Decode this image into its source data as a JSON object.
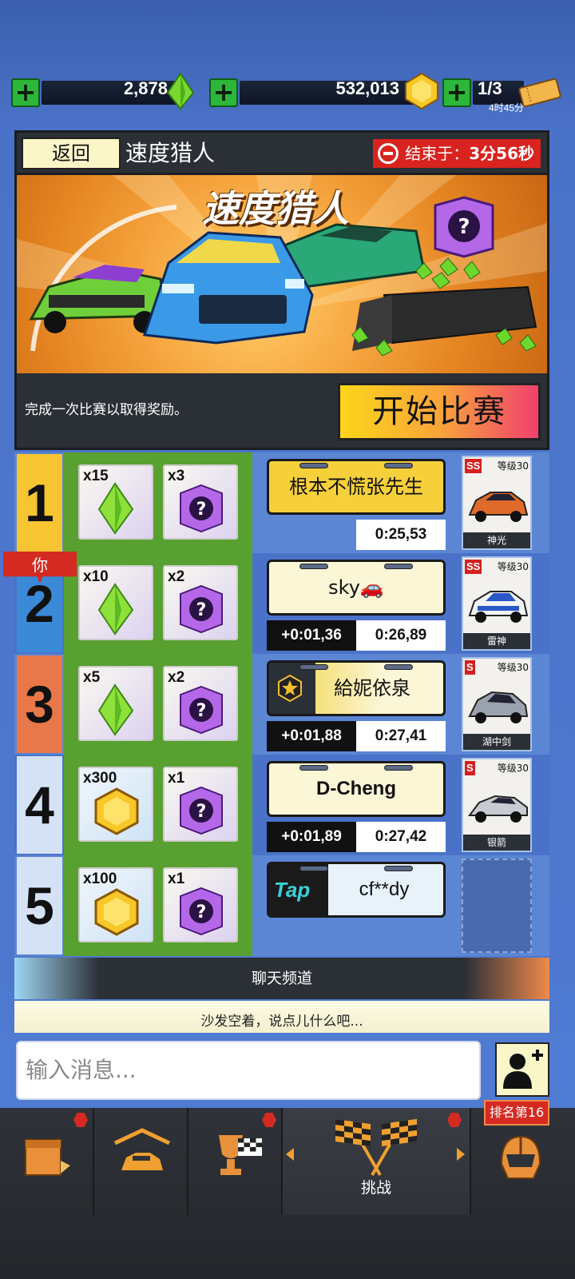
{
  "currencies": {
    "gems": "2,878",
    "coins": "532,013",
    "tickets": "1/3",
    "ticket_timer": "4时45分"
  },
  "header": {
    "back_label": "返回",
    "title": "速度猎人",
    "timer_prefix": "结束于：",
    "timer_value": "3分56秒"
  },
  "banner": {
    "title": "速度猎人"
  },
  "start": {
    "hint": "完成一次比赛以取得奖励。",
    "button_label": "开始比赛"
  },
  "you_tag": "你",
  "leaderboard": [
    {
      "rank": "1",
      "reward_a": {
        "qty": "x15",
        "icon": "gem-icon"
      },
      "reward_b": {
        "qty": "x3",
        "icon": "mystery-box-icon"
      },
      "player": "根本不慌张先生",
      "gap": "",
      "time": "0:25,53",
      "car": {
        "tier": "SS",
        "level": "等级30",
        "name": "神光",
        "color": "#e06a2a"
      }
    },
    {
      "rank": "2",
      "reward_a": {
        "qty": "x10",
        "icon": "gem-icon"
      },
      "reward_b": {
        "qty": "x2",
        "icon": "mystery-box-icon"
      },
      "player": "sky🚗",
      "gap": "+0:01,36",
      "time": "0:26,89",
      "car": {
        "tier": "SS",
        "level": "等级30",
        "name": "雷神",
        "color": "#2a58c8"
      }
    },
    {
      "rank": "3",
      "reward_a": {
        "qty": "x5",
        "icon": "gem-icon"
      },
      "reward_b": {
        "qty": "x2",
        "icon": "mystery-box-icon"
      },
      "player": "給妮依泉",
      "gap": "+0:01,88",
      "time": "0:27,41",
      "car": {
        "tier": "S",
        "level": "等级30",
        "name": "湖中剑",
        "color": "#9aa3ad"
      }
    },
    {
      "rank": "4",
      "reward_a": {
        "qty": "x300",
        "icon": "coin-icon"
      },
      "reward_b": {
        "qty": "x1",
        "icon": "mystery-box-icon"
      },
      "player": "D-Cheng",
      "gap": "+0:01,89",
      "time": "0:27,42",
      "car": {
        "tier": "S",
        "level": "等级30",
        "name": "银箭",
        "color": "#c8ccd2"
      }
    },
    {
      "rank": "5",
      "reward_a": {
        "qty": "x100",
        "icon": "coin-icon"
      },
      "reward_b": {
        "qty": "x1",
        "icon": "mystery-box-icon"
      },
      "player": "cf**dy",
      "plate_badge": "Tap",
      "gap": "",
      "time": "",
      "car": null
    }
  ],
  "chat": {
    "header": "聊天频道",
    "message": "沙发空着，说点儿什么吧...",
    "input_placeholder": "输入消息..."
  },
  "nav": {
    "active_label": "挑战",
    "rank_tag": "排名第16"
  },
  "colors": {
    "rank1": "#f6c531",
    "rank2": "#3a8ad8",
    "rank3": "#e8784a",
    "rank45": "#d5e2f6",
    "accent_red": "#d52a22"
  }
}
